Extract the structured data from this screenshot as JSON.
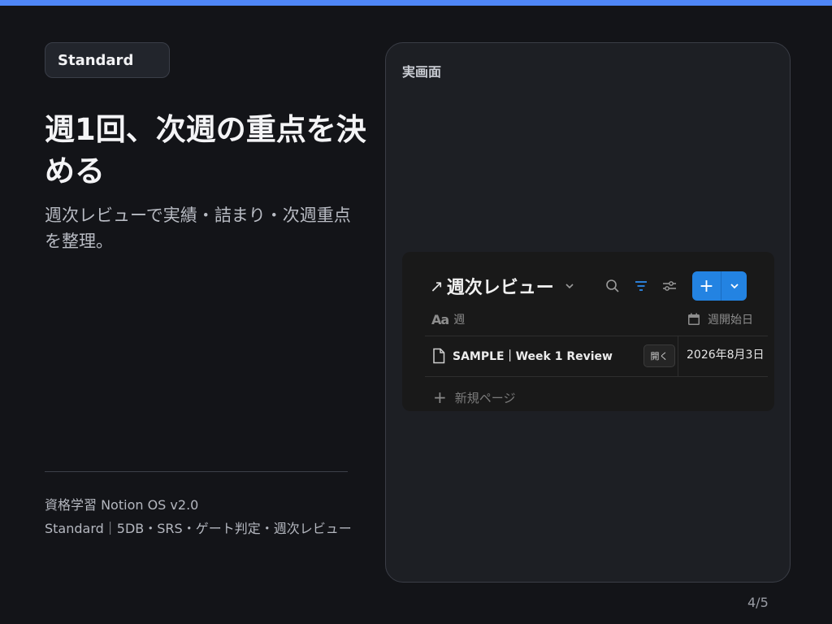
{
  "left": {
    "badge": "Standard",
    "title": "週1回、次週の重点を決める",
    "subtitle": "週次レビューで実績・詰まり・次週重点を整理。",
    "footer_line1": "資格学習 Notion OS v2.0",
    "footer_line2": "Standard｜5DB・SRS・ゲート判定・週次レビュー"
  },
  "frame": {
    "label": "実画面",
    "db": {
      "arrow": "↗",
      "title": "週次レビュー",
      "columns": {
        "title_col_icon": "Aa",
        "title_col": "週",
        "date_col": "週開始日"
      },
      "rows": [
        {
          "title": "SAMPLE｜Week 1 Review",
          "open_label": "開く",
          "date": "2026年8月3日"
        }
      ],
      "new_page_label": "新規ページ",
      "new_button_label": "+",
      "accent": "#2383e2"
    }
  },
  "page_number": "4/5",
  "colors": {
    "top_bar": "#4f86f7",
    "background": "#131418"
  }
}
